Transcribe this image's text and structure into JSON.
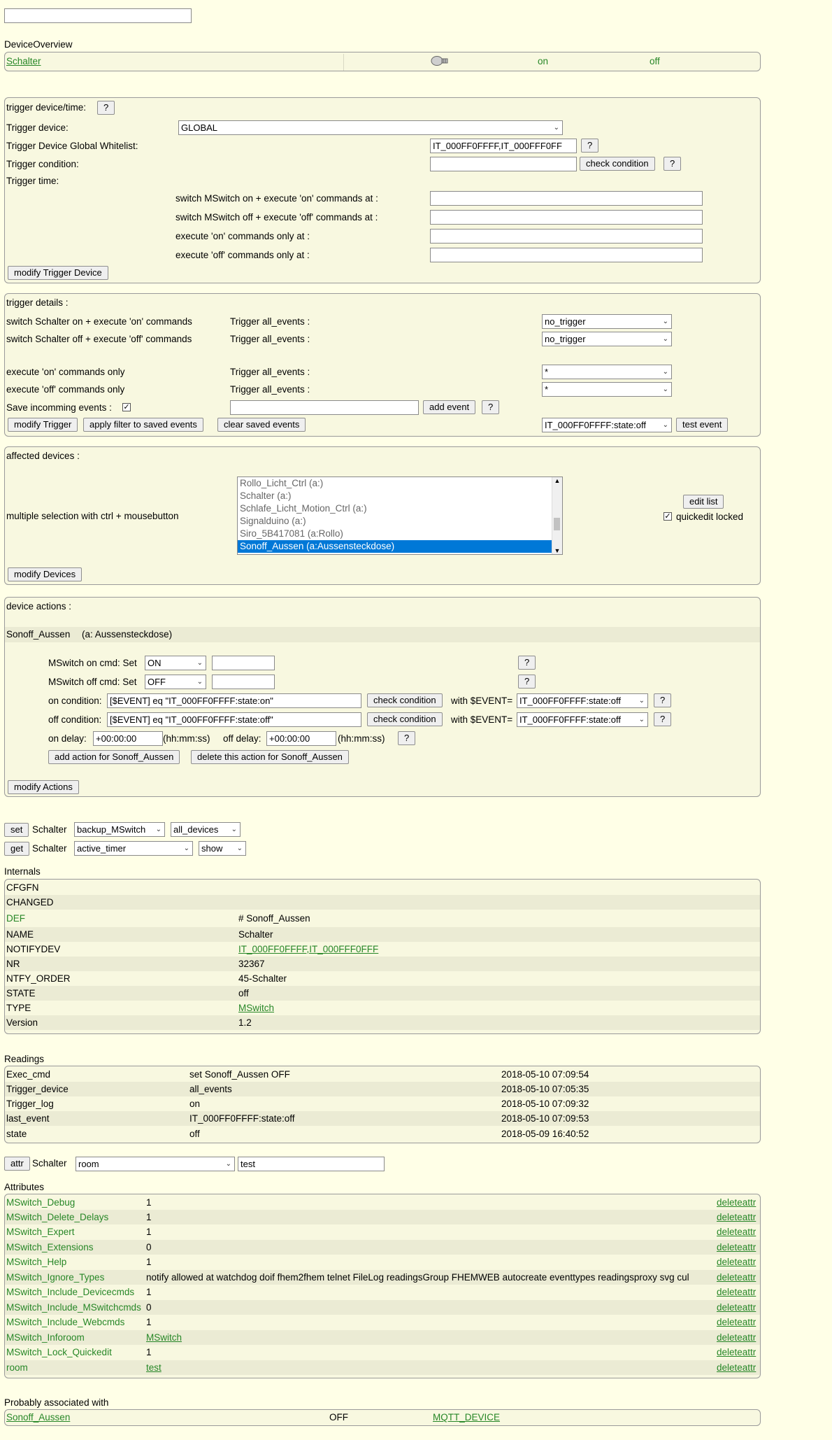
{
  "header": {
    "search_value": ""
  },
  "overview": {
    "title": "DeviceOverview",
    "device": "Schalter",
    "on": "on",
    "off": "off"
  },
  "trigger_device": {
    "legend": "trigger device/time:",
    "help": "?",
    "trigger_device_label": "Trigger device:",
    "trigger_device_value": "GLOBAL",
    "whitelist_label": "Trigger Device Global Whitelist:",
    "whitelist_value": "IT_000FF0FFFF,IT_000FFF0FF",
    "condition_label": "Trigger condition:",
    "condition_value": "",
    "check_condition": "check condition",
    "time_label": "Trigger time:",
    "times": [
      {
        "label": "switch MSwitch on + execute 'on' commands at :",
        "value": ""
      },
      {
        "label": "switch MSwitch off + execute 'off' commands at :",
        "value": ""
      },
      {
        "label": "execute 'on' commands only at :",
        "value": ""
      },
      {
        "label": "execute 'off' commands only at :",
        "value": ""
      }
    ],
    "modify_button": "modify Trigger Device"
  },
  "trigger_details": {
    "legend": "trigger details :",
    "rows": [
      {
        "label": "switch Schalter on + execute 'on' commands",
        "trigger": "Trigger all_events :",
        "value": "no_trigger"
      },
      {
        "label": "switch Schalter off + execute 'off' commands",
        "trigger": "Trigger all_events :",
        "value": "no_trigger"
      },
      {
        "label": "execute 'on' commands only",
        "trigger": "Trigger all_events :",
        "value": "*"
      },
      {
        "label": "execute 'off' commands only",
        "trigger": "Trigger all_events :",
        "value": "*"
      }
    ],
    "save_events_label": "Save incomming events :",
    "add_event_value": "",
    "add_event": "add event",
    "modify_trigger": "modify Trigger",
    "apply_filter": "apply filter to saved events",
    "clear_saved": "clear saved events",
    "event_select": "IT_000FF0FFFF:state:off",
    "test_event": "test event"
  },
  "affected": {
    "legend": "affected devices :",
    "hint": "multiple selection with ctrl + mousebutton",
    "options": [
      "Rollo_Licht_Ctrl (a:)",
      "Schalter (a:)",
      "Schlafe_Licht_Motion_Ctrl (a:)",
      "Signalduino (a:)",
      "Siro_5B417081 (a:Rollo)",
      "Sonoff_Aussen (a:Aussensteckdose)"
    ],
    "edit_list": "edit list",
    "quickedit": "quickedit locked",
    "modify_devices": "modify Devices"
  },
  "actions": {
    "legend": "device actions :",
    "device_name": "Sonoff_Aussen",
    "device_alias": "(a: Aussensteckdose)",
    "on_cmd_label": "MSwitch on cmd: Set",
    "on_cmd_value": "ON",
    "off_cmd_label": "MSwitch off cmd: Set",
    "off_cmd_value": "OFF",
    "on_cond_label": "on condition:",
    "on_cond_value": "[$EVENT] eq \"IT_000FF0FFFF:state:on\"",
    "off_cond_label": "off condition:",
    "off_cond_value": "[$EVENT] eq \"IT_000FF0FFFF:state:off\"",
    "check_condition": "check condition",
    "with_event": "with $EVENT=",
    "event_value": "IT_000FF0FFFF:state:off",
    "on_delay_label": "on delay:",
    "on_delay_value": "+00:00:00",
    "hhmmss": "(hh:mm:ss)",
    "off_delay_label": "off delay:",
    "off_delay_value": "+00:00:00",
    "add_action": "add action for Sonoff_Aussen",
    "delete_action": "delete this action for Sonoff_Aussen",
    "modify_actions": "modify Actions",
    "help": "?"
  },
  "setget": {
    "set": "set",
    "get": "get",
    "device": "Schalter",
    "set_cmd": "backup_MSwitch",
    "set_arg": "all_devices",
    "get_cmd": "active_timer",
    "get_arg": "show"
  },
  "internals": {
    "title": "Internals",
    "rows": [
      {
        "key": "CFGFN",
        "value": ""
      },
      {
        "key": "CHANGED",
        "value": ""
      },
      {
        "key": "DEF",
        "value": "# Sonoff_Aussen"
      },
      {
        "key": "NAME",
        "value": "Schalter"
      },
      {
        "key": "NOTIFYDEV",
        "value": "IT_000FF0FFFF,IT_000FFF0FFF"
      },
      {
        "key": "NR",
        "value": "32367"
      },
      {
        "key": "NTFY_ORDER",
        "value": "45-Schalter"
      },
      {
        "key": "STATE",
        "value": "off"
      },
      {
        "key": "TYPE",
        "value": "MSwitch"
      },
      {
        "key": "Version",
        "value": "1.2"
      }
    ]
  },
  "readings": {
    "title": "Readings",
    "rows": [
      {
        "key": "Exec_cmd",
        "value": "set Sonoff_Aussen OFF",
        "time": "2018-05-10 07:09:54"
      },
      {
        "key": "Trigger_device",
        "value": "all_events",
        "time": "2018-05-10 07:05:35"
      },
      {
        "key": "Trigger_log",
        "value": "on",
        "time": "2018-05-10 07:09:32"
      },
      {
        "key": "last_event",
        "value": "IT_000FF0FFFF:state:off",
        "time": "2018-05-10 07:09:53"
      },
      {
        "key": "state",
        "value": "off",
        "time": "2018-05-09 16:40:52"
      }
    ]
  },
  "attr_cmd": {
    "button": "attr",
    "device": "Schalter",
    "attr": "room",
    "value": "test"
  },
  "attributes": {
    "title": "Attributes",
    "delete_label": "deleteattr",
    "rows": [
      {
        "key": "MSwitch_Debug",
        "value": "1"
      },
      {
        "key": "MSwitch_Delete_Delays",
        "value": "1"
      },
      {
        "key": "MSwitch_Expert",
        "value": "1"
      },
      {
        "key": "MSwitch_Extensions",
        "value": "0"
      },
      {
        "key": "MSwitch_Help",
        "value": "1"
      },
      {
        "key": "MSwitch_Ignore_Types",
        "value": "notify allowed at watchdog doif fhem2fhem telnet FileLog readingsGroup FHEMWEB autocreate eventtypes readingsproxy svg cul"
      },
      {
        "key": "MSwitch_Include_Devicecmds",
        "value": "1"
      },
      {
        "key": "MSwitch_Include_MSwitchcmds",
        "value": "0"
      },
      {
        "key": "MSwitch_Include_Webcmds",
        "value": "1"
      },
      {
        "key": "MSwitch_Inforoom",
        "value": "MSwitch"
      },
      {
        "key": "MSwitch_Lock_Quickedit",
        "value": "1"
      },
      {
        "key": "room",
        "value": "test"
      }
    ]
  },
  "associated": {
    "title": "Probably associated with",
    "name": "Sonoff_Aussen",
    "state": "OFF",
    "type": "MQTT_DEVICE"
  },
  "colors": {
    "link": "#278727",
    "bg": "#FFFFE7",
    "box": "#F8F8E0",
    "alt": "#EBEBD4"
  }
}
